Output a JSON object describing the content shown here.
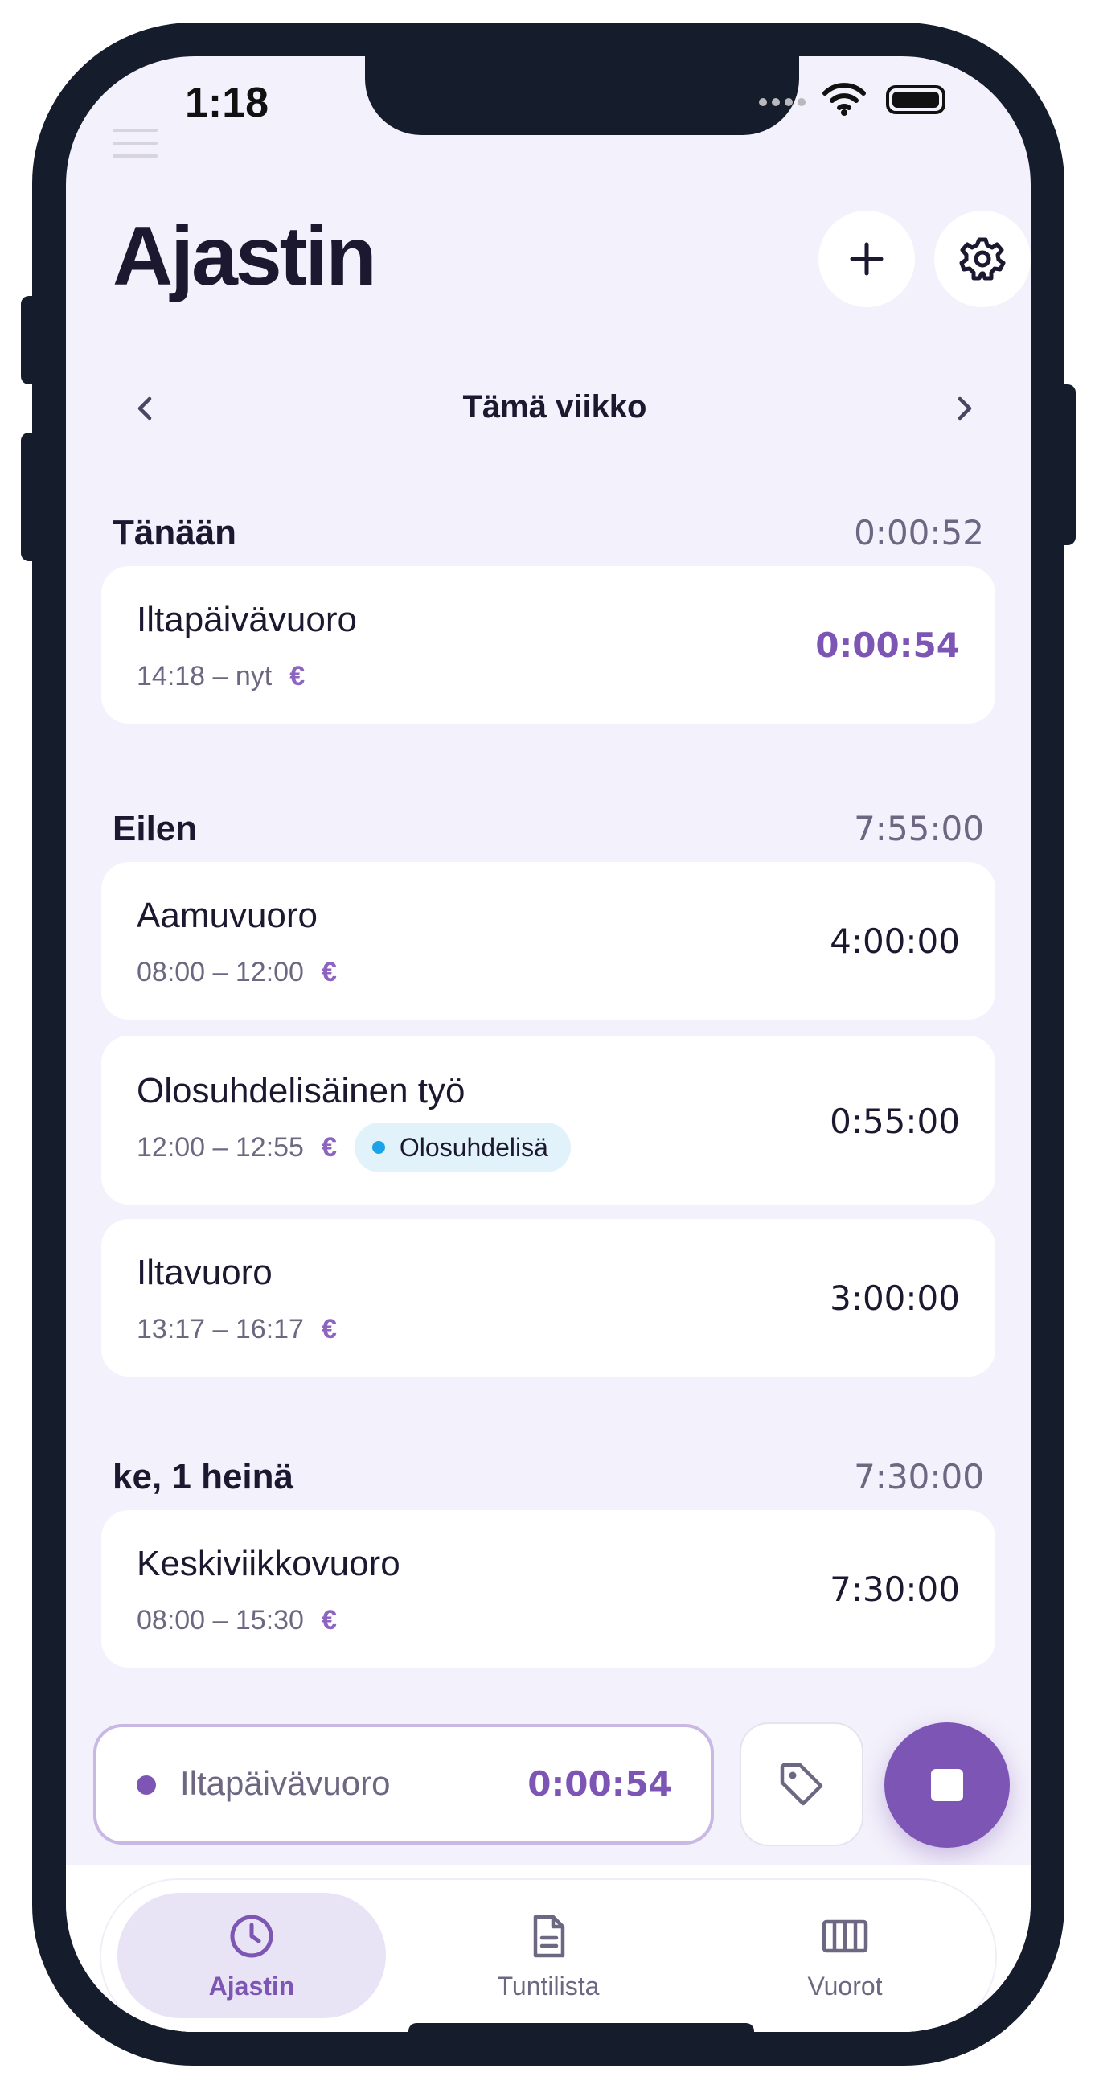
{
  "status": {
    "time": "1:18"
  },
  "header": {
    "title": "Ajastin",
    "add_icon": "plus-icon",
    "settings_icon": "gear-icon"
  },
  "week_nav": {
    "label": "Tämä viikko"
  },
  "sections": [
    {
      "title": "Tänään",
      "total": "0:00:52",
      "entries": [
        {
          "name": "Iltapäivävuoro",
          "time": "14:18 – nyt",
          "euro": "€",
          "duration": "0:00:54",
          "active": true
        }
      ]
    },
    {
      "title": "Eilen",
      "total": "7:55:00",
      "entries": [
        {
          "name": "Aamuvuoro",
          "time": "08:00 – 12:00",
          "euro": "€",
          "duration": "4:00:00"
        },
        {
          "name": "Olosuhdelisäinen työ",
          "time": "12:00 – 12:55",
          "euro": "€",
          "duration": "0:55:00",
          "tag": "Olosuhdelisä"
        },
        {
          "name": "Iltavuoro",
          "time": "13:17 – 16:17",
          "euro": "€",
          "duration": "3:00:00"
        }
      ]
    },
    {
      "title": "ke, 1 heinä",
      "total": "7:30:00",
      "entries": [
        {
          "name": "Keskiviikkovuoro",
          "time": "08:00 – 15:30",
          "euro": "€",
          "duration": "7:30:00"
        }
      ]
    }
  ],
  "running": {
    "name": "Iltapäivävuoro",
    "time": "0:00:54"
  },
  "tabs": [
    {
      "label": "Ajastin",
      "icon": "clock-icon",
      "active": true
    },
    {
      "label": "Tuntilista",
      "icon": "document-icon",
      "active": false
    },
    {
      "label": "Vuorot",
      "icon": "columns-icon",
      "active": false
    }
  ],
  "colors": {
    "accent": "#7d55b4",
    "background": "#f3f1fb",
    "muted_text": "#6d6782",
    "tag_background": "#e1f2fb",
    "tag_dot": "#1aa3e8",
    "frame": "#151c2b"
  }
}
